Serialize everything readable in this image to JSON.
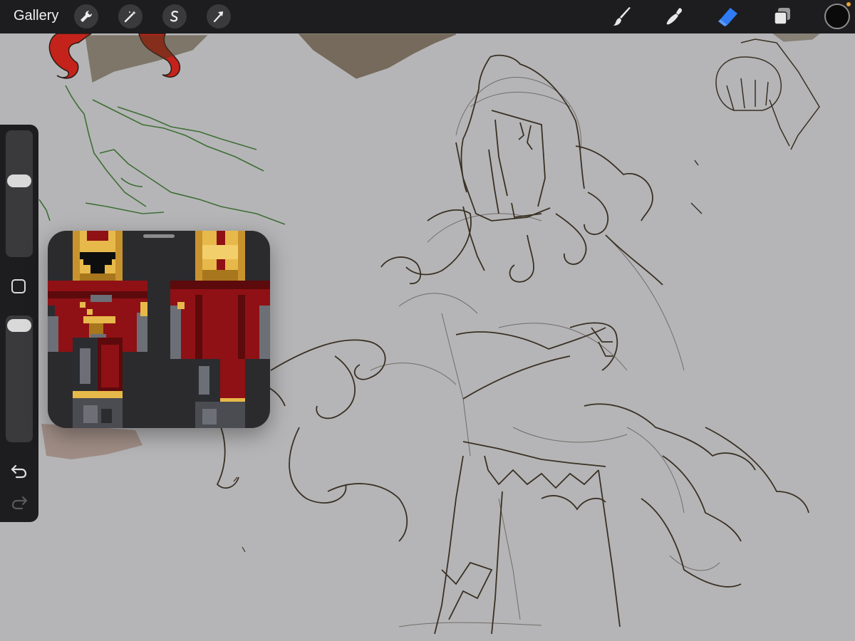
{
  "topbar": {
    "gallery_label": "Gallery",
    "actions": [
      {
        "name": "wrench-icon"
      },
      {
        "name": "adjustments-magic-wand-icon"
      },
      {
        "name": "selection-s-icon"
      },
      {
        "name": "transform-arrow-icon"
      }
    ],
    "tools": [
      {
        "name": "brush-icon",
        "active": false
      },
      {
        "name": "smudge-icon",
        "active": false
      },
      {
        "name": "eraser-icon",
        "active": true
      },
      {
        "name": "layers-icon",
        "active": false
      }
    ],
    "current_color": "#0a0a0a",
    "accent_dot_color": "#e8a33b",
    "active_tool_color": "#2f7bf5"
  },
  "sidebar": {
    "brush_size_level": 0.9,
    "opacity_level": 0.96,
    "undo_icon": "undo-arrow-icon",
    "redo_icon": "redo-arrow-icon"
  },
  "canvas": {
    "background_color": "#b5b5b7",
    "sketch_color": "#3a3024",
    "hair_color": "#c4231b",
    "green_sketch_color": "#3e6e35",
    "hatching_color": "#4a3a1e"
  },
  "reference_window": {
    "palette": {
      "gold": "#e7b94a",
      "gold_dark": "#a8761c",
      "red": "#8f1115",
      "red_dark": "#5c0a0c",
      "steel": "#6c6f76",
      "steel_dark": "#2a2c30",
      "black": "#0e0e0e"
    }
  }
}
